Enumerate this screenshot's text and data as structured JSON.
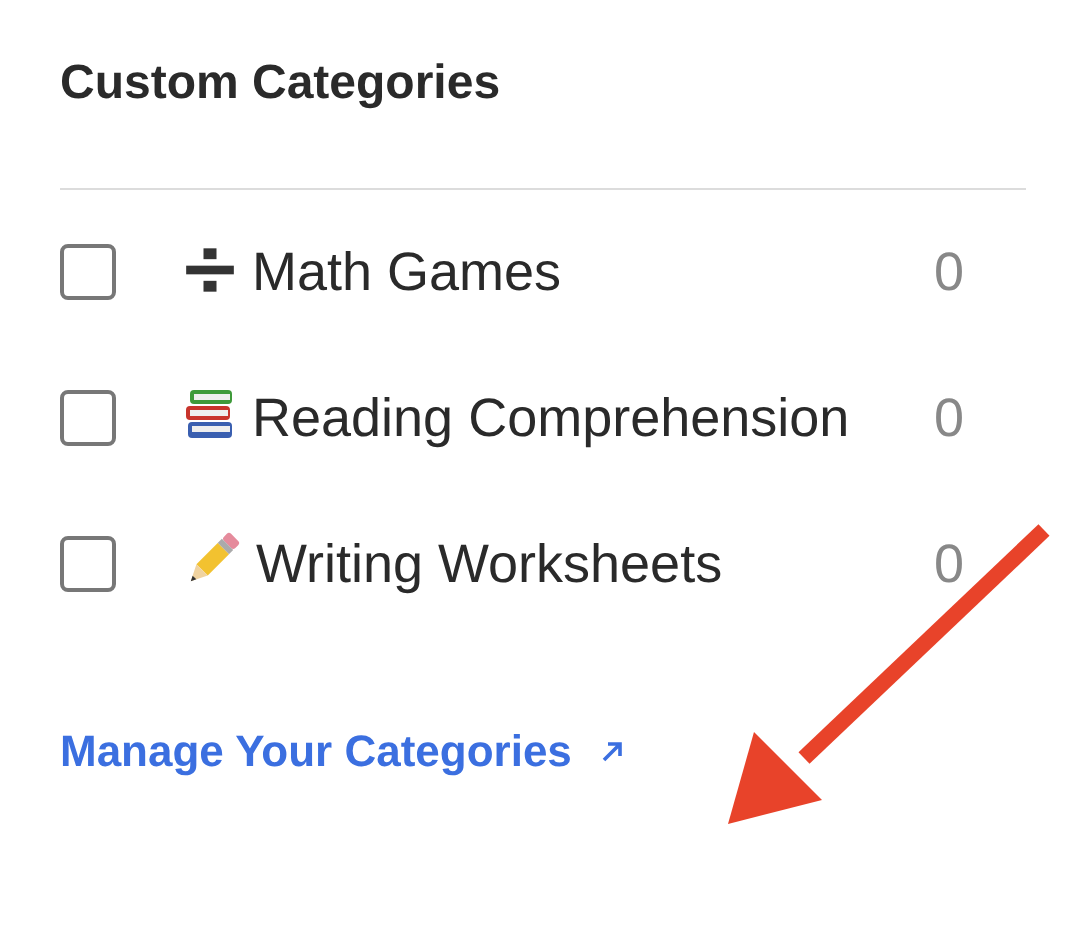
{
  "title": "Custom Categories",
  "categories": [
    {
      "kind": "divide",
      "name": "Math Games",
      "count": "0",
      "checked": false
    },
    {
      "kind": "books",
      "name": "Reading Comprehension",
      "count": "0",
      "checked": false
    },
    {
      "kind": "pencil",
      "name": "Writing Worksheets",
      "count": "0",
      "checked": false
    }
  ],
  "manage_link": {
    "label": "Manage Your Categories"
  }
}
